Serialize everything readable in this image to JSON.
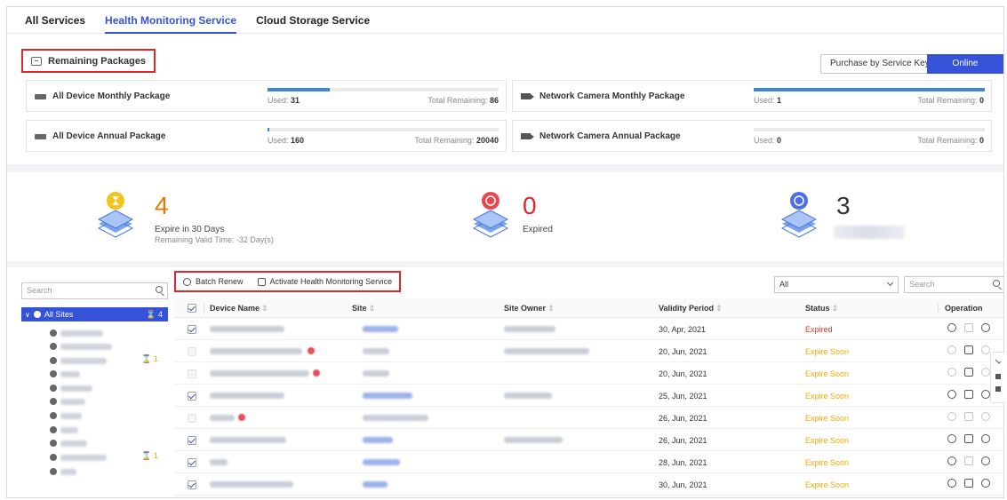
{
  "tabs": [
    {
      "label": "All Services",
      "active": false
    },
    {
      "label": "Health Monitoring Service",
      "active": true
    },
    {
      "label": "Cloud Storage Service",
      "active": false
    }
  ],
  "packages": {
    "title": "Remaining Packages",
    "buttons": {
      "service_key": "Purchase by Service Key",
      "online": "Online Purchase"
    },
    "used_label": "Used:",
    "remaining_label": "Total Remaining:",
    "items": [
      {
        "name": "All Device Monthly Package",
        "used": "31",
        "remaining": "86",
        "used_fraction": 0.27
      },
      {
        "name": "Network Camera Monthly Package",
        "used": "1",
        "remaining": "0",
        "used_fraction": 1.0
      },
      {
        "name": "All Device Annual Package",
        "used": "160",
        "remaining": "20040",
        "used_fraction": 0.008
      },
      {
        "name": "Network Camera Annual Package",
        "used": "0",
        "remaining": "0",
        "used_fraction": 0.0
      }
    ]
  },
  "stats": {
    "expire_soon": {
      "count": "4",
      "label": "Expire in 30 Days",
      "sub": "Remaining Valid Time: -32 Day(s)",
      "color": "#e07b00"
    },
    "expired": {
      "count": "0",
      "label": "Expired",
      "color": "#e0262d"
    },
    "other": {
      "count": "3",
      "color": "#333333"
    }
  },
  "tree": {
    "search_placeholder": "Search",
    "root_label": "All Sites",
    "root_count": "4",
    "counts": [
      "1",
      "1"
    ]
  },
  "toolbar": {
    "batch_renew": "Batch Renew",
    "activate": "Activate Health Monitoring Service",
    "filter_value": "All",
    "search_placeholder": "Search"
  },
  "table": {
    "columns": {
      "device_name": "Device Name",
      "site": "Site",
      "site_owner": "Site Owner",
      "validity": "Validity Period",
      "status": "Status",
      "operation": "Operation"
    },
    "sort_glyph": "⇕",
    "rows": [
      {
        "validity": "30, Apr, 2021",
        "status": "Expired"
      },
      {
        "validity": "20, Jun, 2021",
        "status": "Expire Soon"
      },
      {
        "validity": "20, Jun, 2021",
        "status": "Expire Soon"
      },
      {
        "validity": "25, Jun, 2021",
        "status": "Expire Soon"
      },
      {
        "validity": "26, Jun, 2021",
        "status": "Expire Soon"
      },
      {
        "validity": "26, Jun, 2021",
        "status": "Expire Soon"
      },
      {
        "validity": "28, Jun, 2021",
        "status": "Expire Soon"
      },
      {
        "validity": "30, Jun, 2021",
        "status": "Expire Soon"
      }
    ]
  },
  "colors": {
    "accent": "#3553d6",
    "expired": "#e3322c",
    "expire_soon": "#f0ab00",
    "highlight_border": "#e0262d"
  }
}
